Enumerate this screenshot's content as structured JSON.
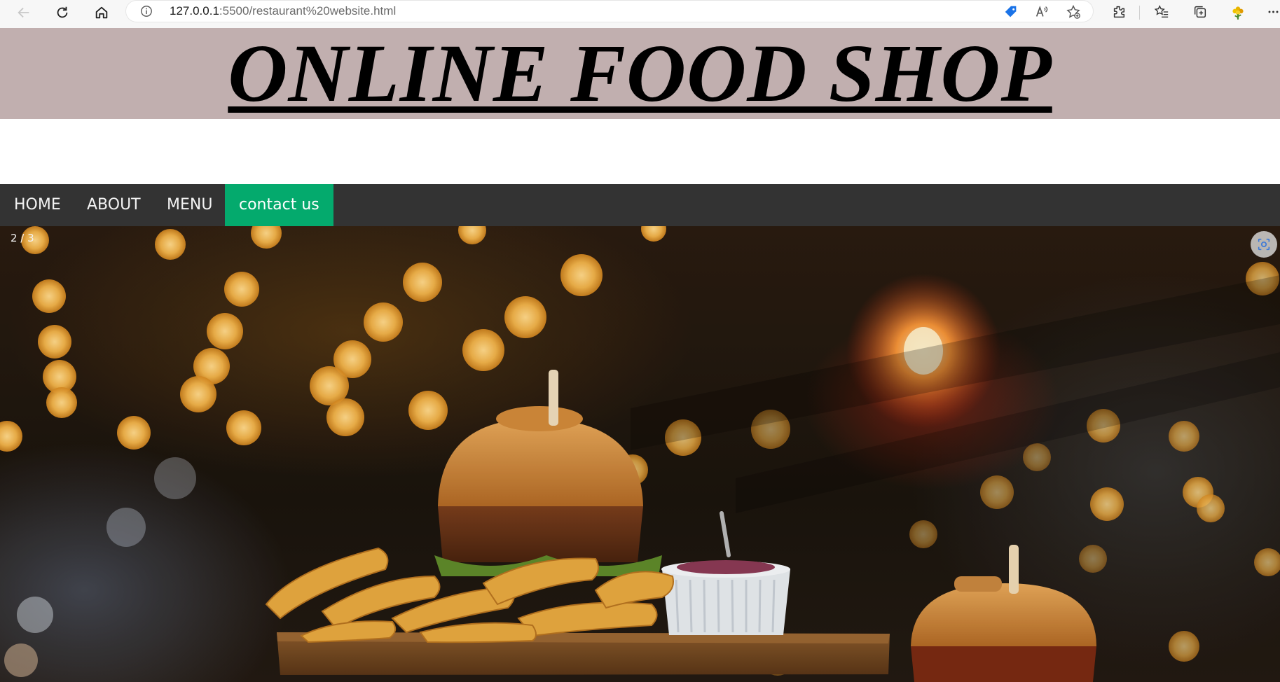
{
  "browser": {
    "url_host": "127.0.0.1",
    "url_rest": ":5500/restaurant%20website.html"
  },
  "header": {
    "title": "ONLINE FOOD SHOP",
    "background": "#c1afaf"
  },
  "nav": {
    "items": [
      {
        "label": "HOME"
      },
      {
        "label": "ABOUT"
      },
      {
        "label": "MENU"
      },
      {
        "label": "contact us",
        "active": true
      }
    ],
    "background": "#333333",
    "active_color": "#04aa6d"
  },
  "slideshow": {
    "counter": "2 / 3",
    "image": "burger-and-fries-photo"
  },
  "icons": {
    "back": "back-arrow-icon",
    "reload": "reload-icon",
    "home": "home-icon",
    "info": "info-icon",
    "visual_search": "visual-search-icon"
  }
}
